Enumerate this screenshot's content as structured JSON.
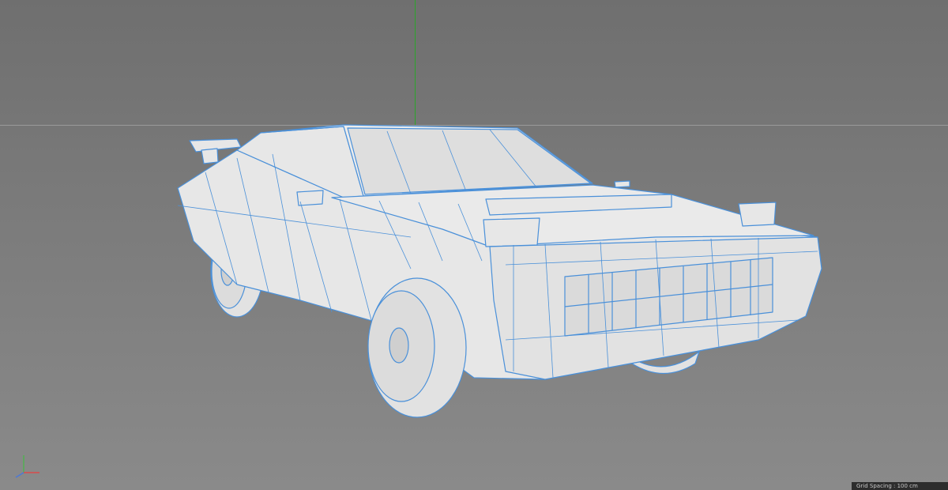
{
  "viewport": {
    "background_top": "#6f6f6f",
    "background_bottom": "#8a8a8a",
    "horizon_color": "#9a9a9a",
    "y_axis_color": "#2aa52a",
    "wire_color": "#4a90d9",
    "model_fill": "#e6e6e6"
  },
  "status_bar": {
    "text": "Grid Spacing : 100 cm"
  },
  "axis_gizmo": {
    "icon": "axis-gizmo-icon",
    "y_color": "#4fb24f",
    "x_color": "#d94a4a",
    "z_color": "#4a78d9"
  }
}
